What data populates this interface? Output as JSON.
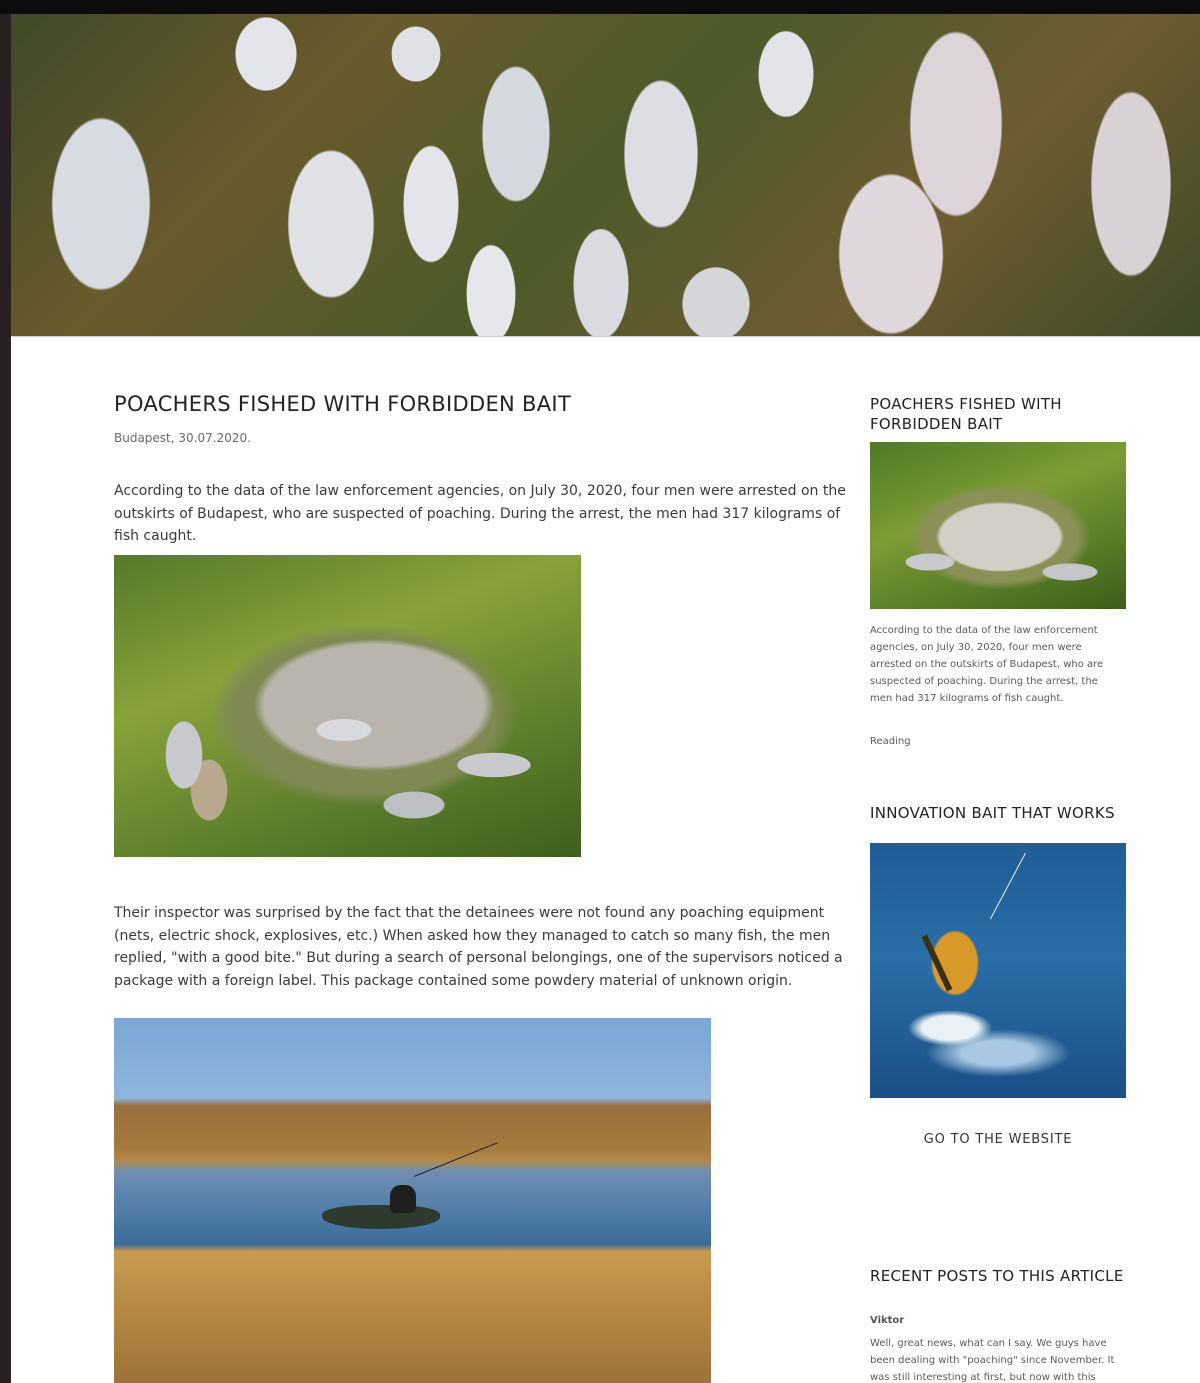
{
  "article": {
    "title": "POACHERS FISHED WITH FORBIDDEN BAIT",
    "meta": "Budapest, 30.07.2020.",
    "paragraphs": [
      "According to the data of the law enforcement agencies, on July 30, 2020, four men were arrested on the outskirts of Budapest, who are suspected of poaching. During the arrest, the men had 317 kilograms of fish caught.",
      "Their inspector was surprised by the fact that the detainees were not found any poaching equipment (nets, electric shock, explosives, etc.) When asked how they managed to catch so many fish, the men replied, \"with a good bite.\" But during a search of personal belongings, one of the supervisors noticed a package with a foreign label. This package contained some powdery material of unknown origin."
    ]
  },
  "sidebar": {
    "promo1": {
      "title": "POACHERS FISHED WITH FORBIDDEN BAIT",
      "excerpt": "According to the data of the law enforcement agencies, on July 30, 2020, four men were arrested on the outskirts of Budapest, who are suspected of poaching. During the arrest, the men had 317 kilograms of fish caught.",
      "link": "Reading"
    },
    "promo2": {
      "title": "INNOVATION BAIT THAT WORKS",
      "button": "GO TO THE WEBSITE"
    },
    "recent": {
      "title": "RECENT POSTS TO THIS ARTICLE",
      "author": "Viktor",
      "text": "Well, great news, what can I say. We guys have been dealing with \"poaching\" since November. It was still interesting at first, but now with this"
    }
  },
  "icons": {
    "hero": "fish-pile-photo",
    "article_image_1": "fish-on-grass-photo",
    "article_image_2": "lake-fisherman-photo",
    "sidebar_image_1": "fish-pile-thumbnail",
    "sidebar_image_2": "perch-jumping-photo"
  }
}
